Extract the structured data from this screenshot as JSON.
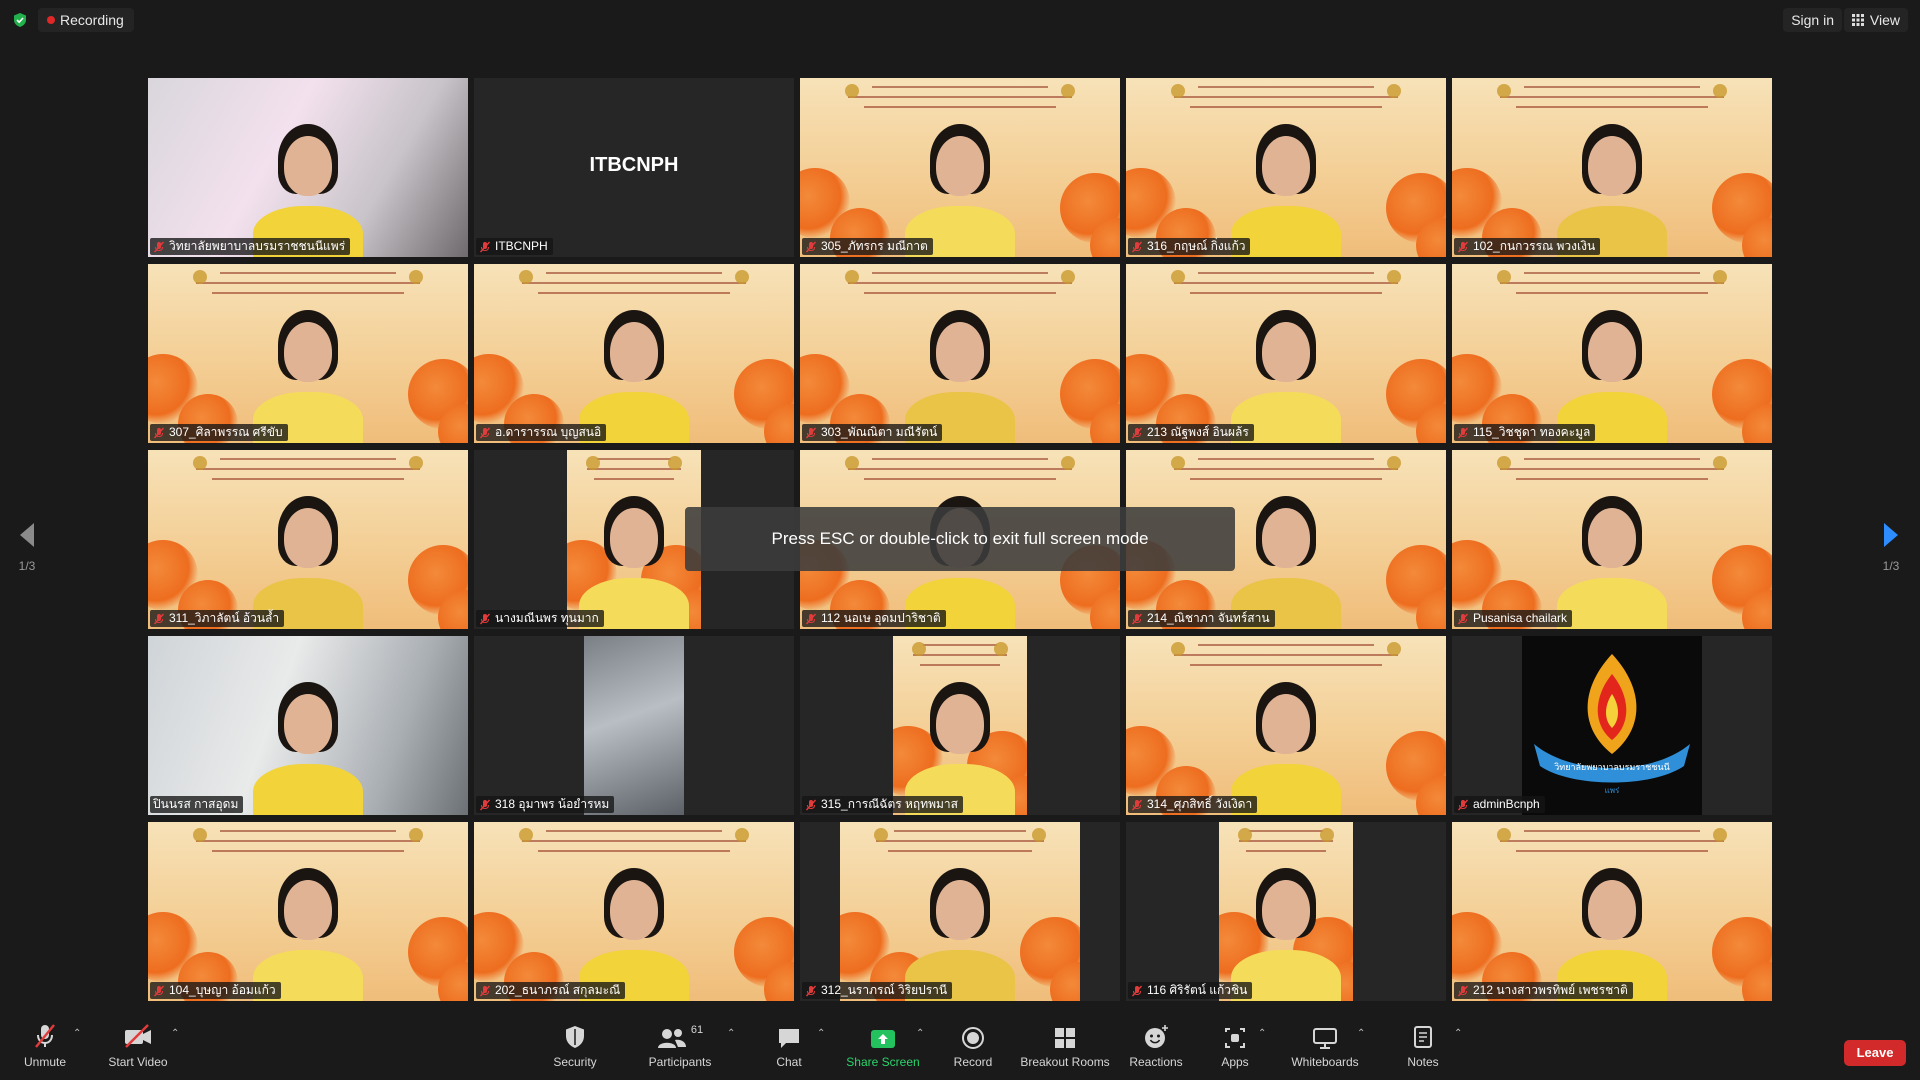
{
  "topbar": {
    "recording_label": "Recording",
    "signin_label": "Sign in",
    "view_label": "View"
  },
  "notice": "Press ESC or double-click to exit full screen mode",
  "paging": {
    "left_count": "1/3",
    "right_count": "1/3"
  },
  "tiles": [
    {
      "name": "วิทยาลัยพยาบาลบรมราชชนนีแพร่",
      "muted": true,
      "active": false,
      "bg": "office"
    },
    {
      "name": "ITBCNPH",
      "muted": true,
      "active": false,
      "bg": "none",
      "display_text": "ITBCNPH"
    },
    {
      "name": "305_ภัทรกร มณีกาต",
      "muted": true,
      "active": false,
      "bg": "orange"
    },
    {
      "name": "316_กฤษณ์ กิ่งแก้ว",
      "muted": true,
      "active": false,
      "bg": "orange"
    },
    {
      "name": "102_กนกวรรณ พวงเงิน",
      "muted": true,
      "active": false,
      "bg": "orange"
    },
    {
      "name": "307_ศิลาพรรณ ศรีขับ",
      "muted": true,
      "active": false,
      "bg": "orange"
    },
    {
      "name": "อ.ดารารรณ บุญสนอิ",
      "muted": true,
      "active": false,
      "bg": "orange"
    },
    {
      "name": "303_พัณณิตา มณีรัตน์",
      "muted": true,
      "active": false,
      "bg": "orange"
    },
    {
      "name": "213 ณัฐพงส์ อินผล้ร",
      "muted": true,
      "active": false,
      "bg": "orange"
    },
    {
      "name": "115_วิชชุดา ทองคะมูล",
      "muted": true,
      "active": false,
      "bg": "orange"
    },
    {
      "name": "311_วิภาลัตน์ อ้วนล้ำ",
      "muted": true,
      "active": false,
      "bg": "orange"
    },
    {
      "name": "นางมณีนพร ทุนมาก",
      "muted": true,
      "active": false,
      "bg": "orange-narrow"
    },
    {
      "name": "112 นอเษ อุดมปาริชาติ",
      "muted": true,
      "active": false,
      "bg": "orange"
    },
    {
      "name": "214_ณิชาภา จันทร์สาน",
      "muted": true,
      "active": false,
      "bg": "orange"
    },
    {
      "name": "Pusanisa chailark",
      "muted": true,
      "active": false,
      "bg": "orange"
    },
    {
      "name": "ปินนรส กาสอุดม",
      "muted": false,
      "active": true,
      "bg": "room"
    },
    {
      "name": "318 อุมาพร น้อยำรหม",
      "muted": true,
      "active": false,
      "bg": "blur-narrow"
    },
    {
      "name": "315_การณีฉัตร หฤทพมาส",
      "muted": true,
      "active": false,
      "bg": "orange-narrow"
    },
    {
      "name": "314_ศุภสิทธิ์ วังเงิดา",
      "muted": true,
      "active": false,
      "bg": "orange"
    },
    {
      "name": "adminBcnph",
      "muted": true,
      "active": false,
      "bg": "logo",
      "logo_text": "วิทยาลัยพยาบาลบรมราชชนนี",
      "logo_subtext": "แพร่"
    },
    {
      "name": "104_บุษญา อ้อมแก้ว",
      "muted": true,
      "active": false,
      "bg": "orange"
    },
    {
      "name": "202_ธนาภรณ์ สกุลมะณี",
      "muted": true,
      "active": false,
      "bg": "orange"
    },
    {
      "name": "312_นราภรณ์ วิริยปรานี",
      "muted": true,
      "active": false,
      "bg": "orange-mid"
    },
    {
      "name": "116 ศิริรัตน์ แก้วชิน",
      "muted": true,
      "active": false,
      "bg": "orange-narrow"
    },
    {
      "name": "212 นางสาวพรทิพย์ เพชรชาติ",
      "muted": true,
      "active": false,
      "bg": "orange"
    }
  ],
  "toolbar": {
    "unmute": "Unmute",
    "start_video": "Start Video",
    "security": "Security",
    "participants": "Participants",
    "participants_count": "61",
    "chat": "Chat",
    "share_screen": "Share Screen",
    "record": "Record",
    "breakout_rooms": "Breakout Rooms",
    "reactions": "Reactions",
    "apps": "Apps",
    "whiteboards": "Whiteboards",
    "notes": "Notes",
    "leave": "Leave"
  },
  "colors": {
    "background": "#1a1a1a",
    "active_speaker": "#9ee43a",
    "leave": "#d22a2a",
    "share": "#2bd46a",
    "recording_dot": "#e02828",
    "mute_icon": "#e23b3b"
  }
}
